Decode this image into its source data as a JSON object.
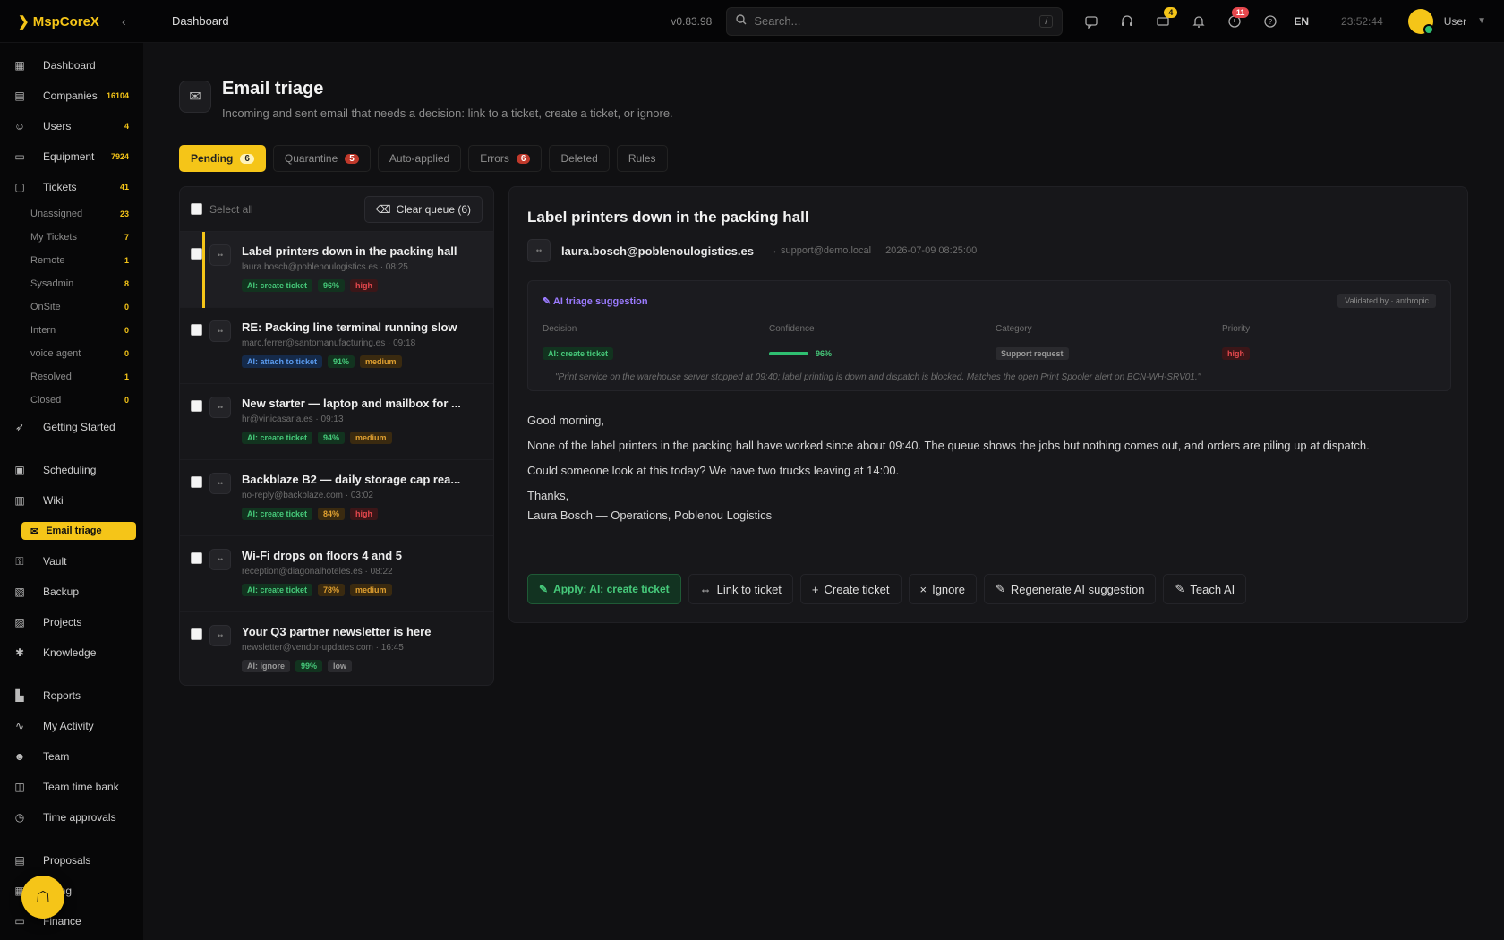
{
  "app": {
    "logo": "MspCoreX",
    "version": "v0.83.98",
    "breadcrumb": "Dashboard",
    "search_placeholder": "Search...",
    "search_shortcut": "/",
    "badge_tickets": "4",
    "badge_alerts": "11",
    "language": "EN",
    "clock": "23:52:44",
    "user": "User"
  },
  "sidebar": {
    "items": [
      {
        "label": "Dashboard",
        "icon": "grid-icon"
      },
      {
        "label": "Companies",
        "count": "16104"
      },
      {
        "label": "Users",
        "count": "4"
      },
      {
        "label": "Equipment",
        "count": "7924"
      },
      {
        "label": "Tickets",
        "count": "41"
      }
    ],
    "ticket_subs": [
      {
        "label": "Unassigned",
        "count": "23"
      },
      {
        "label": "My Tickets",
        "count": "7"
      },
      {
        "label": "Remote",
        "count": "1"
      },
      {
        "label": "Sysadmin",
        "count": "8"
      },
      {
        "label": "OnSite",
        "count": "0"
      },
      {
        "label": "Intern",
        "count": "0"
      },
      {
        "label": "voice agent",
        "count": "0"
      },
      {
        "label": "Resolved",
        "count": "1"
      },
      {
        "label": "Closed",
        "count": "0"
      }
    ],
    "getting_started": "Getting Started",
    "group2": [
      "Scheduling",
      "Wiki",
      "Email triage",
      "Vault",
      "Backup",
      "Projects",
      "Knowledge"
    ],
    "group3": [
      "Reports",
      "My Activity",
      "Team",
      "Team time bank",
      "Time approvals"
    ],
    "group4": [
      "Proposals",
      "Billing",
      "Finance"
    ]
  },
  "page": {
    "title": "Email triage",
    "subtitle": "Incoming and sent email that needs a decision: link to a ticket, create a ticket, or ignore."
  },
  "tabs": [
    {
      "label": "Pending",
      "count": "6"
    },
    {
      "label": "Quarantine",
      "count": "5"
    },
    {
      "label": "Auto-applied",
      "count": ""
    },
    {
      "label": "Errors",
      "count": "6"
    },
    {
      "label": "Deleted",
      "count": ""
    },
    {
      "label": "Rules",
      "count": ""
    }
  ],
  "list": {
    "select_all": "Select all",
    "clear_queue": "Clear queue (6)",
    "items": [
      {
        "title": "Label printers down in the packing hall",
        "meta": "laura.bosch@poblenoulogistics.es · 08:25",
        "decision": "AI: create ticket",
        "decision_class": "c-green",
        "conf": "96%",
        "conf_class": "c-conf",
        "prio": "high",
        "prio_class": "c-red"
      },
      {
        "title": "RE: Packing line terminal running slow",
        "meta": "marc.ferrer@santomanufacturing.es · 09:18",
        "decision": "AI: attach to ticket",
        "decision_class": "c-blue",
        "conf": "91%",
        "conf_class": "c-conf",
        "prio": "medium",
        "prio_class": "c-orange"
      },
      {
        "title": "New starter — laptop and mailbox for ...",
        "meta": "hr@vinicasaria.es · 09:13",
        "decision": "AI: create ticket",
        "decision_class": "c-green",
        "conf": "94%",
        "conf_class": "c-conf",
        "prio": "medium",
        "prio_class": "c-orange"
      },
      {
        "title": "Backblaze B2 — daily storage cap rea...",
        "meta": "no-reply@backblaze.com · 03:02",
        "decision": "AI: create ticket",
        "decision_class": "c-green",
        "conf": "84%",
        "conf_class": "c-conf-o",
        "prio": "high",
        "prio_class": "c-red"
      },
      {
        "title": "Wi-Fi drops on floors 4 and 5",
        "meta": "reception@diagonalhoteles.es · 08:22",
        "decision": "AI: create ticket",
        "decision_class": "c-green",
        "conf": "78%",
        "conf_class": "c-conf-o",
        "prio": "medium",
        "prio_class": "c-orange"
      },
      {
        "title": "Your Q3 partner newsletter is here",
        "meta": "newsletter@vendor-updates.com · 16:45",
        "decision": "AI: ignore",
        "decision_class": "c-gray",
        "conf": "99%",
        "conf_class": "c-conf",
        "prio": "low",
        "prio_class": "c-low"
      }
    ]
  },
  "detail": {
    "title": "Label printers down in the packing hall",
    "from": "laura.bosch@poblenoulogistics.es",
    "to": "→ support@demo.local",
    "date": "2026-07-09 08:25:00",
    "ai": {
      "title": "AI triage suggestion",
      "tag": "Validated by · anthropic",
      "cols": [
        "Decision",
        "Confidence",
        "Category",
        "Priority"
      ],
      "decision": "AI: create ticket",
      "confidence": "96%",
      "category": "Support request",
      "priority": "high",
      "reason": "\"Print service on the warehouse server stopped at 09:40; label printing is down and dispatch is blocked. Matches the open Print Spooler alert on BCN-WH-SRV01.\""
    },
    "body": [
      "Good morning,",
      "None of the label printers in the packing hall have worked since about 09:40. The queue shows the jobs but nothing comes out, and orders are piling up at dispatch.",
      "Could someone look at this today? We have two trucks leaving at 14:00.",
      "Thanks,",
      "Laura Bosch — Operations, Poblenou Logistics"
    ],
    "actions": {
      "apply": "Apply: AI: create ticket",
      "link": "Link to ticket",
      "create": "Create ticket",
      "ignore": "Ignore",
      "regen": "Regenerate AI suggestion",
      "teach": "Teach AI"
    }
  }
}
